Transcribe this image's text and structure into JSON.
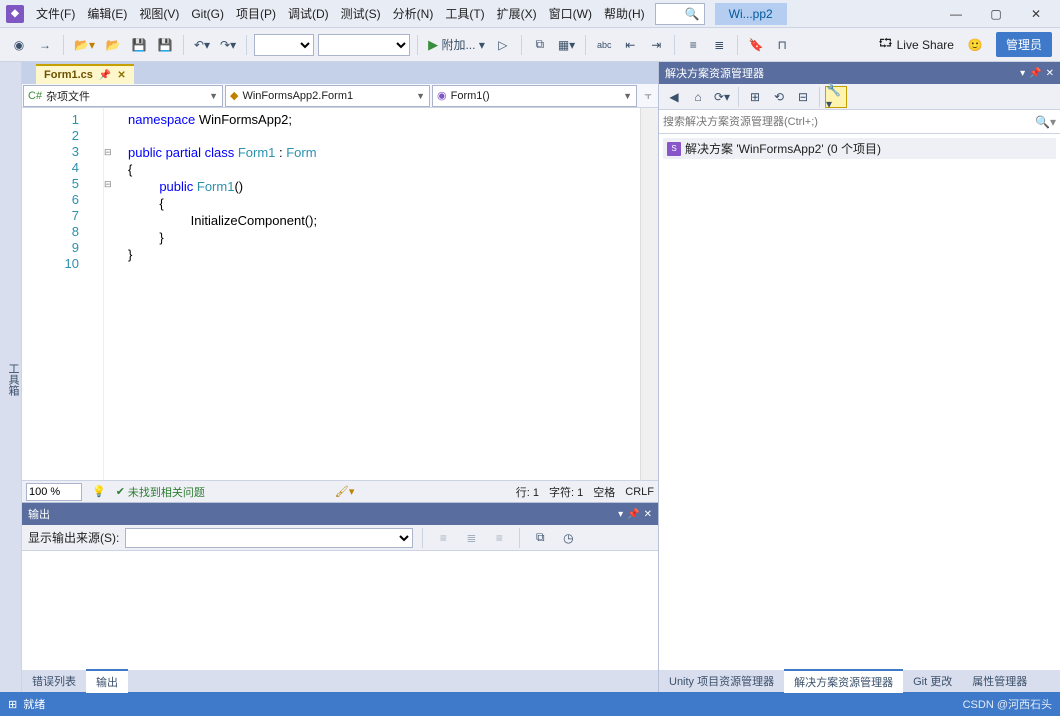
{
  "menu": {
    "file": "文件(F)",
    "edit": "编辑(E)",
    "view": "视图(V)",
    "git": "Git(G)",
    "project": "项目(P)",
    "debug": "调试(D)",
    "test": "测试(S)",
    "analyze": "分析(N)",
    "tools": "工具(T)",
    "extensions": "扩展(X)",
    "window": "窗口(W)",
    "help": "帮助(H)"
  },
  "title": {
    "appname": "Wi...pp2"
  },
  "toolbar": {
    "attach": "附加...",
    "liveshare": "Live Share",
    "admin": "管理员"
  },
  "left_strip": "工具箱",
  "doc_tab": {
    "name": "Form1.cs"
  },
  "nav": {
    "misc": "杂项文件",
    "class": "WinFormsApp2.Form1",
    "member": "Form1()"
  },
  "code": {
    "lines": [
      "1",
      "2",
      "3",
      "4",
      "5",
      "6",
      "7",
      "8",
      "9",
      "10"
    ],
    "l1_a": "namespace",
    "l1_b": " WinFormsApp2;",
    "l3_a": "public partial class ",
    "l3_b": "Form1",
    "l3_c": " : ",
    "l3_d": "Form",
    "l4": "{",
    "l5_a": "public ",
    "l5_b": "Form1",
    "l5_c": "()",
    "l6": "{",
    "l7": "InitializeComponent();",
    "l8": "}",
    "l9": "}"
  },
  "editor_status": {
    "zoom": "100 %",
    "noissues": "未找到相关问题",
    "line": "行: 1",
    "col": "字符: 1",
    "spaces": "空格",
    "eol": "CRLF"
  },
  "output": {
    "title": "输出",
    "src_label": "显示输出来源(S):"
  },
  "bottom_tabs": {
    "errlist": "错误列表",
    "output": "输出"
  },
  "solex": {
    "title": "解决方案资源管理器",
    "search_placeholder": "搜索解决方案资源管理器(Ctrl+;)",
    "solution": "解决方案 'WinFormsApp2' (0 个项目)"
  },
  "right_tabs": {
    "unity": "Unity 项目资源管理器",
    "solex": "解决方案资源管理器",
    "gitchanges": "Git 更改",
    "props": "属性管理器"
  },
  "statusbar": {
    "ready": "就绪",
    "watermark": "CSDN @河西石头"
  }
}
